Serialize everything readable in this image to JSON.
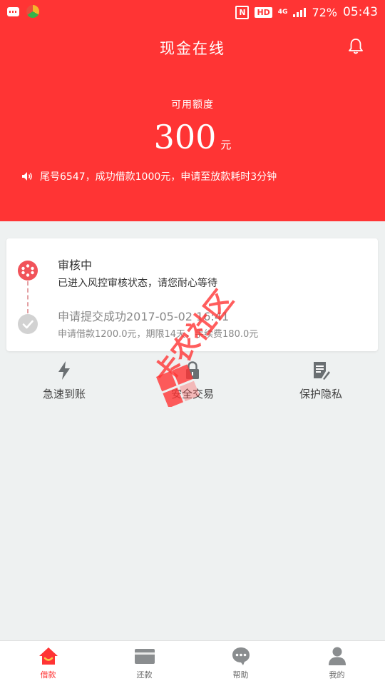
{
  "status_bar": {
    "network": "4G",
    "battery": "72%",
    "time": "05:43",
    "hd_badge": "HD",
    "nfc_badge": "N"
  },
  "header": {
    "title": "现金在线",
    "available_label": "可用额度",
    "amount": "300",
    "unit": "元",
    "notice": "尾号6547，成功借款1000元，申请至放款耗时3分钟"
  },
  "timeline": {
    "steps": [
      {
        "title": "审核中",
        "desc": "已进入风控审核状态，请您耐心等待"
      },
      {
        "title": "申请提交成功2017-05-02 16:41",
        "desc": "申请借款1200.0元，期限14天，手续费180.0元"
      }
    ]
  },
  "features": [
    {
      "label": "急速到账",
      "icon": "lightning-icon"
    },
    {
      "label": "安全交易",
      "icon": "lock-icon"
    },
    {
      "label": "保护隐私",
      "icon": "document-icon"
    }
  ],
  "watermark": {
    "text": "卡农社区"
  },
  "nav": {
    "items": [
      {
        "label": "借款",
        "icon": "home-icon",
        "active": true
      },
      {
        "label": "还款",
        "icon": "card-icon",
        "active": false
      },
      {
        "label": "帮助",
        "icon": "chat-icon",
        "active": false
      },
      {
        "label": "我的",
        "icon": "user-icon",
        "active": false
      }
    ]
  },
  "colors": {
    "brand": "#ff3434",
    "active_dot": "#f1535a",
    "inactive_dot": "#d2d2d2",
    "background": "#eef1f1"
  }
}
